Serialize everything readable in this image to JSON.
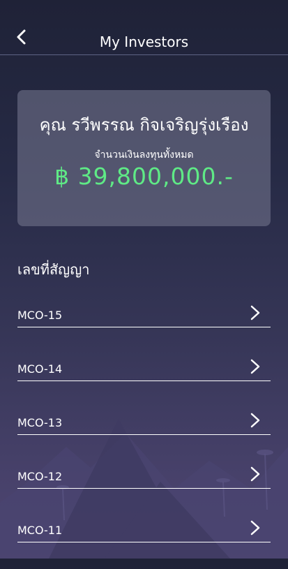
{
  "header": {
    "title": "My Investors",
    "back_icon": "chevron-left-icon"
  },
  "summary": {
    "investor_name": "คุณ รวีพรรณ กิจเจริญรุ่งเรือง",
    "total_label": "จำนวนเงินลงทุนทั้งหมด",
    "total_amount": "฿ 39,800,000.-",
    "amount_color": "#5fea86"
  },
  "contracts": {
    "section_title": "เลขที่สัญญา",
    "items": [
      {
        "label": "MCO-15",
        "icon": "chevron-right-icon"
      },
      {
        "label": "MCO-14",
        "icon": "chevron-right-icon"
      },
      {
        "label": "MCO-13",
        "icon": "chevron-right-icon"
      },
      {
        "label": "MCO-12",
        "icon": "chevron-right-icon"
      },
      {
        "label": "MCO-11",
        "icon": "chevron-right-icon"
      }
    ]
  }
}
